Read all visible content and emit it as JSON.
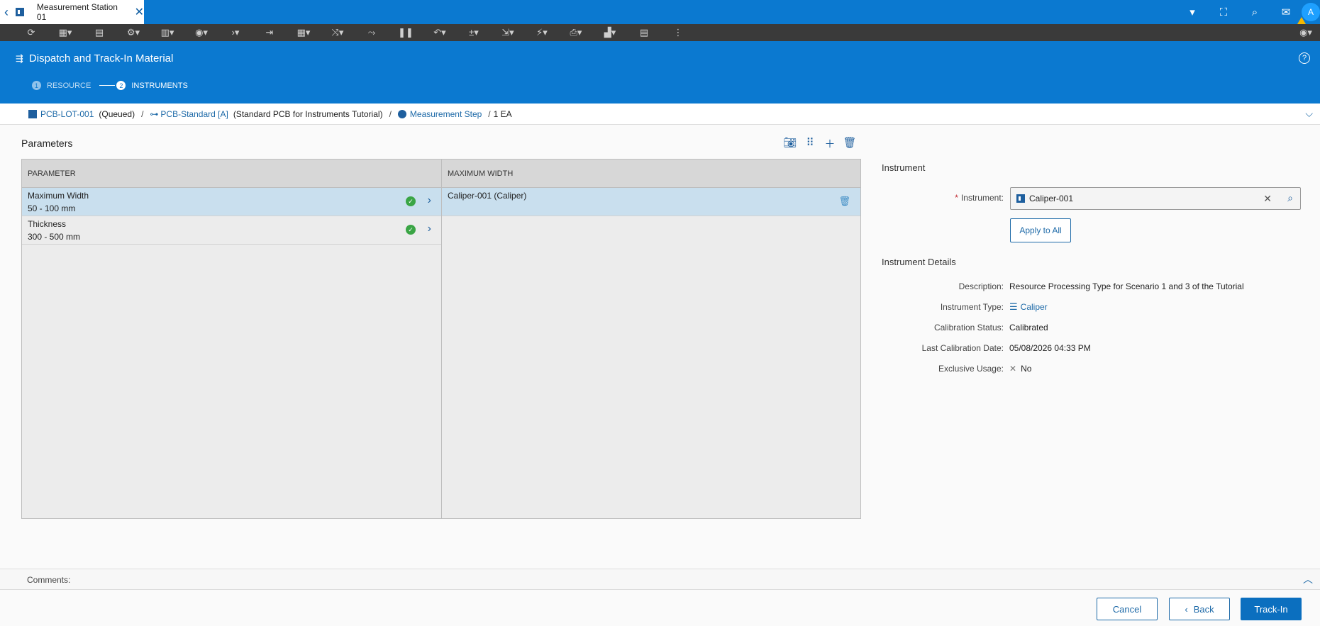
{
  "tab": {
    "title": "Measurement Station 01"
  },
  "header": {
    "title": "Dispatch and Track-In Material",
    "steps": [
      {
        "num": "1",
        "label": "RESOURCE"
      },
      {
        "num": "2",
        "label": "INSTRUMENTS"
      }
    ]
  },
  "user": {
    "initial": "A"
  },
  "breadcrumb": {
    "material": "PCB-LOT-001",
    "material_state": "(Queued)",
    "product": "PCB-Standard [A]",
    "product_desc": "(Standard PCB for Instruments Tutorial)",
    "step": "Measurement Step",
    "quantity": "1 EA",
    "sep": "/"
  },
  "parameters": {
    "title": "Parameters",
    "columns": [
      "PARAMETER",
      "MAXIMUM WIDTH"
    ],
    "rows": [
      {
        "name": "Maximum Width",
        "range": "50 - 100 mm"
      },
      {
        "name": "Thickness",
        "range": "300 - 500 mm"
      }
    ],
    "assigned": "Caliper-001 (Caliper)"
  },
  "instrument": {
    "section_title": "Instrument",
    "label": "Instrument:",
    "required_mark": "*",
    "value": "Caliper-001",
    "apply_all": "Apply to All"
  },
  "details": {
    "section_title": "Instrument Details",
    "description_label": "Description:",
    "description": "Resource Processing Type for Scenario 1 and 3 of the Tutorial",
    "type_label": "Instrument Type:",
    "type": "Caliper",
    "calibration_label": "Calibration Status:",
    "calibration": "Calibrated",
    "last_cal_label": "Last Calibration Date:",
    "last_cal": "05/08/2026 04:33 PM",
    "exclusive_label": "Exclusive Usage:",
    "exclusive": "No"
  },
  "comments": {
    "label": "Comments:"
  },
  "footer": {
    "cancel": "Cancel",
    "back": "Back",
    "trackin": "Track-In"
  }
}
